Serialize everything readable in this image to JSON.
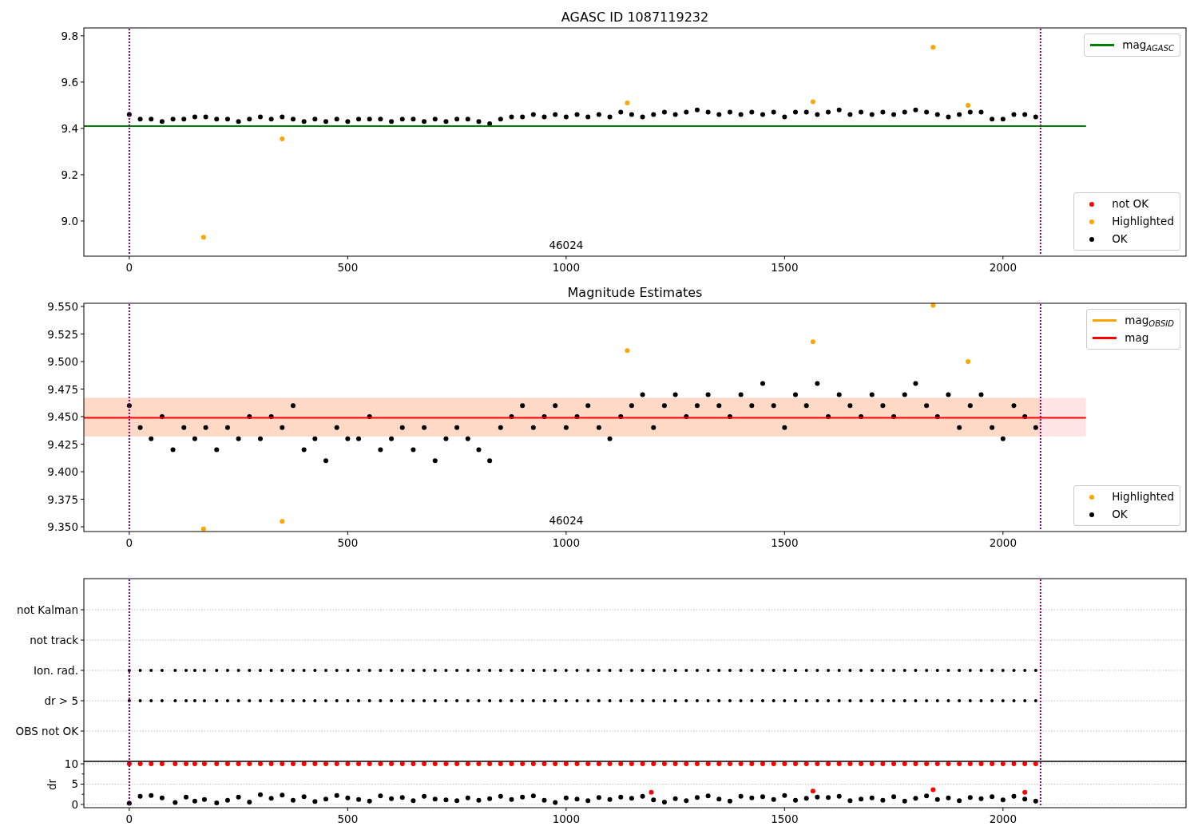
{
  "charts": [
    {
      "chart_data": {
        "type": "scatter",
        "title": "AGASC ID 1087119232",
        "xlim": [
          -104,
          2419
        ],
        "ylim": [
          8.848,
          9.834
        ],
        "xticks": [
          0,
          500,
          1000,
          1500,
          2000
        ],
        "yticks": [
          {
            "value": 9.0,
            "label": "9.0"
          },
          {
            "value": 9.2,
            "label": "9.2"
          },
          {
            "value": 9.4,
            "label": "9.4"
          },
          {
            "value": 9.6,
            "label": "9.6"
          },
          {
            "value": 9.8,
            "label": "9.8"
          }
        ],
        "x": [
          0,
          25,
          50,
          75,
          100,
          125,
          150,
          175,
          200,
          225,
          250,
          275,
          300,
          325,
          350,
          375,
          400,
          425,
          450,
          475,
          500,
          525,
          550,
          575,
          600,
          625,
          650,
          675,
          700,
          725,
          750,
          775,
          800,
          825,
          850,
          875,
          900,
          925,
          950,
          975,
          1000,
          1025,
          1050,
          1075,
          1100,
          1125,
          1150,
          1175,
          1200,
          1225,
          1250,
          1275,
          1300,
          1325,
          1350,
          1375,
          1400,
          1425,
          1450,
          1475,
          1500,
          1525,
          1550,
          1575,
          1600,
          1625,
          1650,
          1675,
          1700,
          1725,
          1750,
          1775,
          1800,
          1825,
          1850,
          1875,
          1900,
          1925,
          1950,
          1975,
          2000,
          2025,
          2050,
          2075
        ],
        "series": [
          {
            "name": "OK",
            "color": "#000000",
            "values": [
              9.46,
              9.44,
              9.44,
              9.43,
              9.44,
              9.44,
              9.45,
              9.45,
              9.44,
              9.44,
              9.43,
              9.44,
              9.45,
              9.44,
              9.45,
              9.44,
              9.43,
              9.44,
              9.43,
              9.44,
              9.43,
              9.44,
              9.44,
              9.44,
              9.43,
              9.44,
              9.44,
              9.43,
              9.44,
              9.43,
              9.44,
              9.44,
              9.43,
              9.42,
              9.44,
              9.45,
              9.45,
              9.46,
              9.45,
              9.46,
              9.45,
              9.46,
              9.45,
              9.46,
              9.45,
              9.47,
              9.46,
              9.45,
              9.46,
              9.47,
              9.46,
              9.47,
              9.48,
              9.47,
              9.46,
              9.47,
              9.46,
              9.47,
              9.46,
              9.47,
              9.45,
              9.47,
              9.47,
              9.46,
              9.47,
              9.48,
              9.46,
              9.47,
              9.46,
              9.47,
              9.46,
              9.47,
              9.48,
              9.47,
              9.46,
              9.45,
              9.46,
              9.47,
              9.47,
              9.44,
              9.44,
              9.46,
              9.46,
              9.45
            ]
          },
          {
            "name": "Highlighted",
            "color": "#ffa500",
            "x": [
              170,
              350,
              1140,
              1565,
              1840,
              1920
            ],
            "values": [
              8.93,
              9.355,
              9.51,
              9.515,
              9.75,
              9.5
            ]
          }
        ],
        "ref_lines": [
          {
            "axis": "y",
            "value": 9.41,
            "color": "#008000"
          },
          {
            "axis": "x",
            "value": 0,
            "color": "#800080"
          },
          {
            "axis": "x",
            "value": 2086,
            "color": "#800080"
          }
        ],
        "annotations": [
          "46024"
        ],
        "legend": "lower right"
      },
      "legends": [
        {
          "entries": [
            {
              "kind": "line",
              "color": "#008000",
              "label": "mag$_{AGASC}$"
            }
          ]
        }
      ],
      "extra_legend_entries": [
        {
          "kind": "dot",
          "color": "#ff0000",
          "label": "not OK"
        }
      ]
    },
    {
      "chart_data": {
        "type": "scatter",
        "title": "Magnitude Estimates",
        "xlim": [
          -104,
          2419
        ],
        "ylim": [
          9.3457,
          9.5529
        ],
        "xticks": [
          0,
          500,
          1000,
          1500,
          2000
        ],
        "yticks": [
          {
            "value": 9.35,
            "label": "9.350"
          },
          {
            "value": 9.375,
            "label": "9.375"
          },
          {
            "value": 9.4,
            "label": "9.400"
          },
          {
            "value": 9.425,
            "label": "9.425"
          },
          {
            "value": 9.45,
            "label": "9.450"
          },
          {
            "value": 9.475,
            "label": "9.475"
          },
          {
            "value": 9.5,
            "label": "9.500"
          },
          {
            "value": 9.525,
            "label": "9.525"
          },
          {
            "value": 9.55,
            "label": "9.550"
          }
        ],
        "x": [
          0,
          25,
          50,
          75,
          100,
          125,
          150,
          175,
          200,
          225,
          250,
          275,
          300,
          325,
          350,
          375,
          400,
          425,
          450,
          475,
          500,
          525,
          550,
          575,
          600,
          625,
          650,
          675,
          700,
          725,
          750,
          775,
          800,
          825,
          850,
          875,
          900,
          925,
          950,
          975,
          1000,
          1025,
          1050,
          1075,
          1100,
          1125,
          1150,
          1175,
          1200,
          1225,
          1250,
          1275,
          1300,
          1325,
          1350,
          1375,
          1400,
          1425,
          1450,
          1475,
          1500,
          1525,
          1550,
          1575,
          1600,
          1625,
          1650,
          1675,
          1700,
          1725,
          1750,
          1775,
          1800,
          1825,
          1850,
          1875,
          1900,
          1925,
          1950,
          1975,
          2000,
          2025,
          2050,
          2075
        ],
        "series": [
          {
            "name": "OK",
            "color": "#000000",
            "values": [
              9.46,
              9.44,
              9.43,
              9.45,
              9.42,
              9.44,
              9.43,
              9.44,
              9.42,
              9.44,
              9.43,
              9.45,
              9.43,
              9.45,
              9.44,
              9.46,
              9.42,
              9.43,
              9.41,
              9.44,
              9.43,
              9.43,
              9.45,
              9.42,
              9.43,
              9.44,
              9.42,
              9.44,
              9.41,
              9.43,
              9.44,
              9.43,
              9.42,
              9.41,
              9.44,
              9.45,
              9.46,
              9.44,
              9.45,
              9.46,
              9.44,
              9.45,
              9.46,
              9.44,
              9.43,
              9.45,
              9.46,
              9.47,
              9.44,
              9.46,
              9.47,
              9.45,
              9.46,
              9.47,
              9.46,
              9.45,
              9.47,
              9.46,
              9.48,
              9.46,
              9.44,
              9.47,
              9.46,
              9.48,
              9.45,
              9.47,
              9.46,
              9.45,
              9.47,
              9.46,
              9.45,
              9.47,
              9.48,
              9.46,
              9.45,
              9.47,
              9.44,
              9.46,
              9.47,
              9.44,
              9.43,
              9.46,
              9.45,
              9.44
            ]
          },
          {
            "name": "Highlighted",
            "color": "#ffa500",
            "x": [
              170,
              350,
              1140,
              1565,
              1840,
              1920
            ],
            "values": [
              9.348,
              9.355,
              9.51,
              9.518,
              9.551,
              9.5
            ]
          }
        ],
        "bands": [
          {
            "axis": "y",
            "from": 9.432,
            "to": 9.467,
            "color": "#ffe5e5"
          },
          {
            "axis": "y",
            "from": 9.432,
            "to": 9.467,
            "color": "#fdd9c6"
          }
        ],
        "ref_lines": [
          {
            "axis": "y",
            "value": 9.449,
            "color": "#ff0000"
          },
          {
            "axis": "x",
            "value": 0,
            "color": "#800080"
          },
          {
            "axis": "x",
            "value": 2086,
            "color": "#800080"
          }
        ],
        "annotations": [
          "46024"
        ],
        "legend": "lower right"
      },
      "legends": [
        {
          "entries": [
            {
              "kind": "line",
              "color": "#ffa500",
              "label": "mag$_{OBSID}$"
            },
            {
              "kind": "line",
              "color": "#ff0000",
              "label": "mag"
            }
          ]
        }
      ]
    }
  ],
  "flag_panel": {
    "rows": [
      {
        "label": "not Kalman",
        "flagged": false
      },
      {
        "label": "not track",
        "flagged": false
      },
      {
        "label": "Ion. rad.",
        "flagged": true
      },
      {
        "label": "dr > 5",
        "flagged": true
      },
      {
        "label": "OBS not OK",
        "flagged": false
      }
    ]
  },
  "dr_chart": {
    "chart_data": {
      "type": "scatter",
      "ylabel": "dr",
      "grid": true,
      "xlim": [
        -104,
        2419
      ],
      "ylim": [
        -0.8,
        10.6
      ],
      "xticks": [
        0,
        500,
        1000,
        1500,
        2000
      ],
      "yticks": [
        0,
        5,
        10
      ],
      "x": [
        0,
        25,
        50,
        75,
        105,
        130,
        150,
        172,
        200,
        225,
        250,
        275,
        300,
        325,
        350,
        375,
        400,
        425,
        450,
        475,
        500,
        525,
        550,
        575,
        600,
        625,
        650,
        675,
        700,
        725,
        750,
        775,
        800,
        825,
        850,
        875,
        900,
        925,
        950,
        975,
        1000,
        1025,
        1050,
        1075,
        1100,
        1125,
        1150,
        1175,
        1200,
        1225,
        1250,
        1275,
        1300,
        1325,
        1350,
        1375,
        1400,
        1425,
        1450,
        1475,
        1500,
        1525,
        1550,
        1575,
        1600,
        1625,
        1650,
        1675,
        1700,
        1725,
        1750,
        1775,
        1800,
        1825,
        1850,
        1875,
        1900,
        1925,
        1950,
        1975,
        2000,
        2025,
        2050,
        2075
      ],
      "series": [
        {
          "color": "#000000",
          "values": [
            0.3,
            2.0,
            2.2,
            1.6,
            0.5,
            1.8,
            0.8,
            1.2,
            0.4,
            1.0,
            1.8,
            0.6,
            2.4,
            1.5,
            2.3,
            1.0,
            1.9,
            0.7,
            1.3,
            2.2,
            1.6,
            1.2,
            0.8,
            2.1,
            1.4,
            1.7,
            0.9,
            2.0,
            1.3,
            1.1,
            0.9,
            1.6,
            1.0,
            1.4,
            2.0,
            1.2,
            1.8,
            2.1,
            1.0,
            0.5,
            1.6,
            1.3,
            0.9,
            1.7,
            1.2,
            1.8,
            1.5,
            2.0,
            1.1,
            0.6,
            1.4,
            0.9,
            1.7,
            2.1,
            1.3,
            0.8,
            2.0,
            1.6,
            1.9,
            1.2,
            2.2,
            1.0,
            1.5,
            1.8,
            1.7,
            2.0,
            0.9,
            1.3,
            1.6,
            1.0,
            1.9,
            0.8,
            1.5,
            2.1,
            1.2,
            1.6,
            0.9,
            1.7,
            1.4,
            1.9,
            1.1,
            2.0,
            1.3,
            0.8
          ]
        },
        {
          "color": "#ff0000",
          "x": [
            1195,
            1565,
            1840,
            2050
          ],
          "values": [
            3.0,
            3.3,
            3.6,
            3.0
          ]
        },
        {
          "color": "#ff0000",
          "values": [
            10,
            10,
            10,
            10,
            10,
            10,
            10,
            10,
            10,
            10,
            10,
            10,
            10,
            10,
            10,
            10,
            10,
            10,
            10,
            10,
            10,
            10,
            10,
            10,
            10,
            10,
            10,
            10,
            10,
            10,
            10,
            10,
            10,
            10,
            10,
            10,
            10,
            10,
            10,
            10,
            10,
            10,
            10,
            10,
            10,
            10,
            10,
            10,
            10,
            10,
            10,
            10,
            10,
            10,
            10,
            10,
            10,
            10,
            10,
            10,
            10,
            10,
            10,
            10,
            10,
            10,
            10,
            10,
            10,
            10,
            10,
            10,
            10,
            10,
            10,
            10,
            10,
            10,
            10,
            10,
            10,
            10,
            10,
            10
          ]
        }
      ],
      "ref_lines": [
        {
          "axis": "x",
          "value": 0,
          "color": "#800080"
        },
        {
          "axis": "x",
          "value": 2086,
          "color": "#800080"
        }
      ]
    }
  }
}
